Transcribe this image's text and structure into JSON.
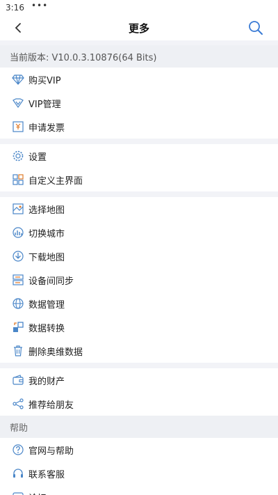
{
  "status": {
    "time": "3:16",
    "dots": "•••"
  },
  "header": {
    "title": "更多"
  },
  "version": "当前版本: V10.0.3.10876(64 Bits)",
  "groups": [
    {
      "items": [
        {
          "label": "购买VIP",
          "icon": "diamond-icon"
        },
        {
          "label": "VIP管理",
          "icon": "vip-icon"
        },
        {
          "label": "申请发票",
          "icon": "invoice-icon"
        }
      ]
    },
    {
      "items": [
        {
          "label": "设置",
          "icon": "gear-icon"
        },
        {
          "label": "自定义主界面",
          "icon": "layout-icon"
        }
      ]
    },
    {
      "items": [
        {
          "label": "选择地图",
          "icon": "map-icon"
        },
        {
          "label": "切换城市",
          "icon": "city-icon"
        },
        {
          "label": "下载地图",
          "icon": "download-icon"
        },
        {
          "label": "设备间同步",
          "icon": "sync-icon"
        },
        {
          "label": "数据管理",
          "icon": "globe-icon"
        },
        {
          "label": "数据转换",
          "icon": "convert-icon"
        },
        {
          "label": "删除奥维数据",
          "icon": "trash-icon"
        }
      ]
    },
    {
      "items": [
        {
          "label": "我的财产",
          "icon": "wallet-icon"
        },
        {
          "label": "推荐给朋友",
          "icon": "share-icon"
        }
      ]
    }
  ],
  "help": {
    "title": "帮助",
    "items": [
      {
        "label": "官网与帮助",
        "icon": "help-icon"
      },
      {
        "label": "联系客服",
        "icon": "headset-icon"
      },
      {
        "label": "论坛",
        "icon": "forum-icon"
      }
    ]
  },
  "colors": {
    "accent": "#3a7bd5",
    "icon": "#4a86c8"
  }
}
